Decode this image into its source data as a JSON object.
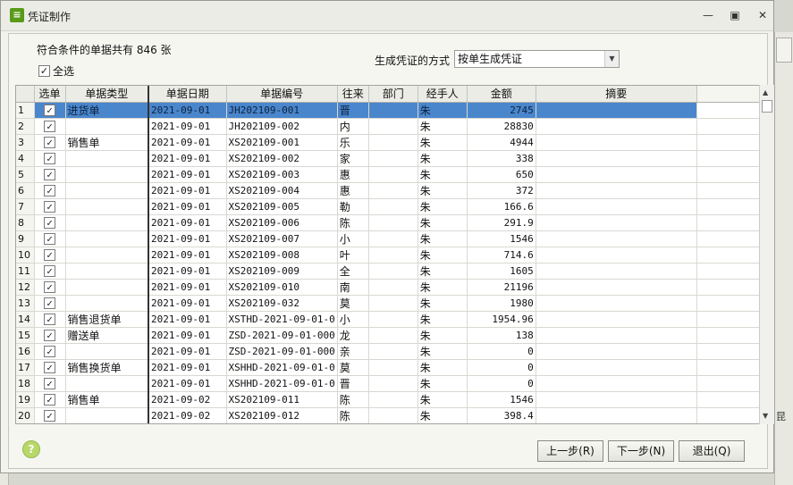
{
  "window": {
    "title": "凭证制作",
    "icon": "app-lock-icon"
  },
  "header": {
    "count_text": "符合条件的单据共有 846 张",
    "select_all_label": "全选",
    "mode_label": "生成凭证的方式",
    "mode_value": "按单生成凭证"
  },
  "table": {
    "columns": [
      "选单",
      "单据类型",
      "单据日期",
      "单据编号",
      "往来",
      "部门",
      "经手人",
      "金额",
      "摘要"
    ],
    "rows": [
      {
        "n": "1",
        "type": "进货单",
        "date": "2021-09-01",
        "code": "JH202109-001",
        "party": "晋",
        "dept": "",
        "handler": "朱",
        "amount": "2745",
        "memo": ""
      },
      {
        "n": "2",
        "type": "",
        "date": "2021-09-01",
        "code": "JH202109-002",
        "party": "内",
        "dept": "",
        "handler": "朱",
        "amount": "28830",
        "memo": ""
      },
      {
        "n": "3",
        "type": "销售单",
        "date": "2021-09-01",
        "code": "XS202109-001",
        "party": "乐",
        "dept": "",
        "handler": "朱",
        "amount": "4944",
        "memo": ""
      },
      {
        "n": "4",
        "type": "",
        "date": "2021-09-01",
        "code": "XS202109-002",
        "party": "家",
        "dept": "",
        "handler": "朱",
        "amount": "338",
        "memo": ""
      },
      {
        "n": "5",
        "type": "",
        "date": "2021-09-01",
        "code": "XS202109-003",
        "party": "惠",
        "dept": "",
        "handler": "朱",
        "amount": "650",
        "memo": ""
      },
      {
        "n": "6",
        "type": "",
        "date": "2021-09-01",
        "code": "XS202109-004",
        "party": "惠",
        "dept": "",
        "handler": "朱",
        "amount": "372",
        "memo": ""
      },
      {
        "n": "7",
        "type": "",
        "date": "2021-09-01",
        "code": "XS202109-005",
        "party": "勒",
        "dept": "",
        "handler": "朱",
        "amount": "166.6",
        "memo": ""
      },
      {
        "n": "8",
        "type": "",
        "date": "2021-09-01",
        "code": "XS202109-006",
        "party": "陈",
        "dept": "",
        "handler": "朱",
        "amount": "291.9",
        "memo": ""
      },
      {
        "n": "9",
        "type": "",
        "date": "2021-09-01",
        "code": "XS202109-007",
        "party": "小",
        "dept": "",
        "handler": "朱",
        "amount": "1546",
        "memo": ""
      },
      {
        "n": "10",
        "type": "",
        "date": "2021-09-01",
        "code": "XS202109-008",
        "party": "叶",
        "dept": "",
        "handler": "朱",
        "amount": "714.6",
        "memo": ""
      },
      {
        "n": "11",
        "type": "",
        "date": "2021-09-01",
        "code": "XS202109-009",
        "party": "全",
        "dept": "",
        "handler": "朱",
        "amount": "1605",
        "memo": ""
      },
      {
        "n": "12",
        "type": "",
        "date": "2021-09-01",
        "code": "XS202109-010",
        "party": "南",
        "dept": "",
        "handler": "朱",
        "amount": "21196",
        "memo": ""
      },
      {
        "n": "13",
        "type": "",
        "date": "2021-09-01",
        "code": "XS202109-032",
        "party": "莫",
        "dept": "",
        "handler": "朱",
        "amount": "1980",
        "memo": ""
      },
      {
        "n": "14",
        "type": "销售退货单",
        "date": "2021-09-01",
        "code": "XSTHD-2021-09-01-0",
        "party": "小",
        "dept": "",
        "handler": "朱",
        "amount": "1954.96",
        "memo": ""
      },
      {
        "n": "15",
        "type": "赠送单",
        "date": "2021-09-01",
        "code": "ZSD-2021-09-01-000",
        "party": "龙",
        "dept": "",
        "handler": "朱",
        "amount": "138",
        "memo": ""
      },
      {
        "n": "16",
        "type": "",
        "date": "2021-09-01",
        "code": "ZSD-2021-09-01-000",
        "party": "亲",
        "dept": "",
        "handler": "朱",
        "amount": "0",
        "memo": ""
      },
      {
        "n": "17",
        "type": "销售换货单",
        "date": "2021-09-01",
        "code": "XSHHD-2021-09-01-0",
        "party": "莫",
        "dept": "",
        "handler": "朱",
        "amount": "0",
        "memo": ""
      },
      {
        "n": "18",
        "type": "",
        "date": "2021-09-01",
        "code": "XSHHD-2021-09-01-0",
        "party": "晋",
        "dept": "",
        "handler": "朱",
        "amount": "0",
        "memo": ""
      },
      {
        "n": "19",
        "type": "销售单",
        "date": "2021-09-02",
        "code": "XS202109-011",
        "party": "陈",
        "dept": "",
        "handler": "朱",
        "amount": "1546",
        "memo": ""
      },
      {
        "n": "20",
        "type": "",
        "date": "2021-09-02",
        "code": "XS202109-012",
        "party": "陈",
        "dept": "",
        "handler": "朱",
        "amount": "398.4",
        "memo": ""
      }
    ]
  },
  "buttons": {
    "prev": "上一步(R)",
    "next": "下一步(N)",
    "exit": "退出(Q)"
  },
  "background": {
    "right_text": "昆"
  },
  "colors": {
    "selection": "#4a86cc",
    "help": "#b8d86a"
  }
}
